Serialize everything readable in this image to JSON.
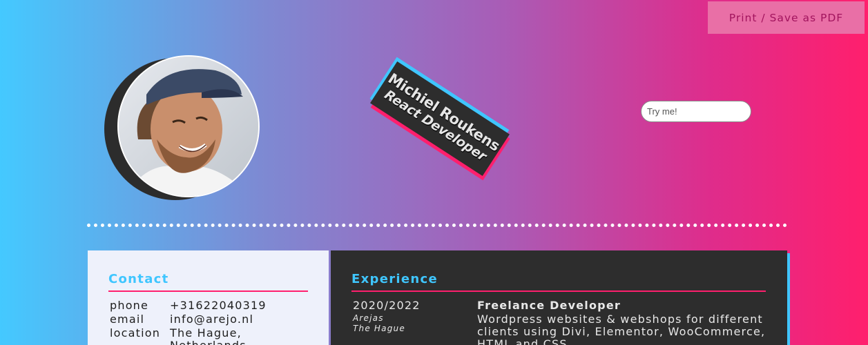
{
  "header": {
    "print_label": "Print / Save as PDF",
    "name": "Michiel Roukens",
    "role": "React Developer",
    "try_placeholder": "Try me!"
  },
  "colors": {
    "accent_blue": "#3fc6ff",
    "accent_pink": "#ff1f6d",
    "dark_card": "#2d2d2d"
  },
  "contact": {
    "title": "Contact",
    "phone_label": "phone",
    "phone": "+31622040319",
    "email_label": "email",
    "email": "info@arejo.nl",
    "location_label": "location",
    "location_line1": "The Hague,",
    "location_line2": "Netherlands"
  },
  "experience": {
    "title": "Experience",
    "items": [
      {
        "period": "2020/2022",
        "company": "Arejas",
        "city": "The Hague",
        "position": "Freelance Developer",
        "description_lines": [
          "Wordpress websites & webshops for different",
          "clients using Divi, Elementor, WooCommerce,",
          "HTML and CSS"
        ]
      }
    ]
  }
}
